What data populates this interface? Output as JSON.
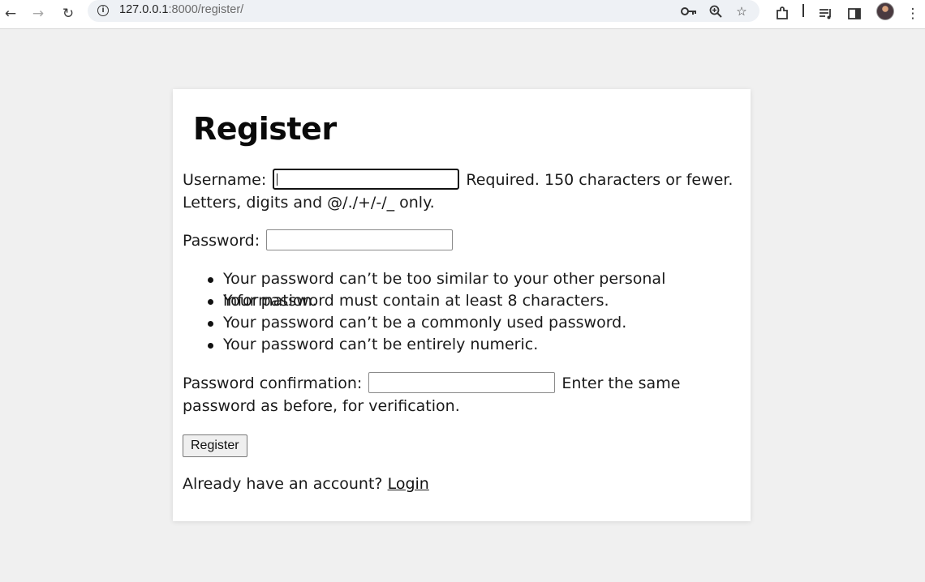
{
  "browser": {
    "url_host": "127.0.0.1",
    "url_rest": ":8000/register/",
    "icons": {
      "back": "arrow-left",
      "forward": "arrow-right",
      "reload": "reload",
      "site_info": "info",
      "password": "key",
      "zoom": "magnifier",
      "bookmark": "star",
      "extensions": "puzzle",
      "media": "queue-music",
      "sidepanel": "side-panel",
      "profile": "avatar",
      "menu": "kebab"
    }
  },
  "page": {
    "title": "Register",
    "username": {
      "label": "Username:",
      "help": "Required. 150 characters or fewer. Letters, digits and @/./+/-/_ only.",
      "value": ""
    },
    "password": {
      "label": "Password:",
      "value": "",
      "rules": [
        "Your password can’t be too similar to your other personal information.",
        "Your password must contain at least 8 characters.",
        "Your password can’t be a commonly used password.",
        "Your password can’t be entirely numeric."
      ]
    },
    "password_confirmation": {
      "label": "Password confirmation:",
      "help": "Enter the same password as before, for verification.",
      "value": ""
    },
    "submit_label": "Register",
    "footer_text": "Already have an account?",
    "login_link": "Login"
  },
  "colors": {
    "page_background": "#f0f0f0",
    "card_background": "#ffffff",
    "text": "#111111"
  }
}
